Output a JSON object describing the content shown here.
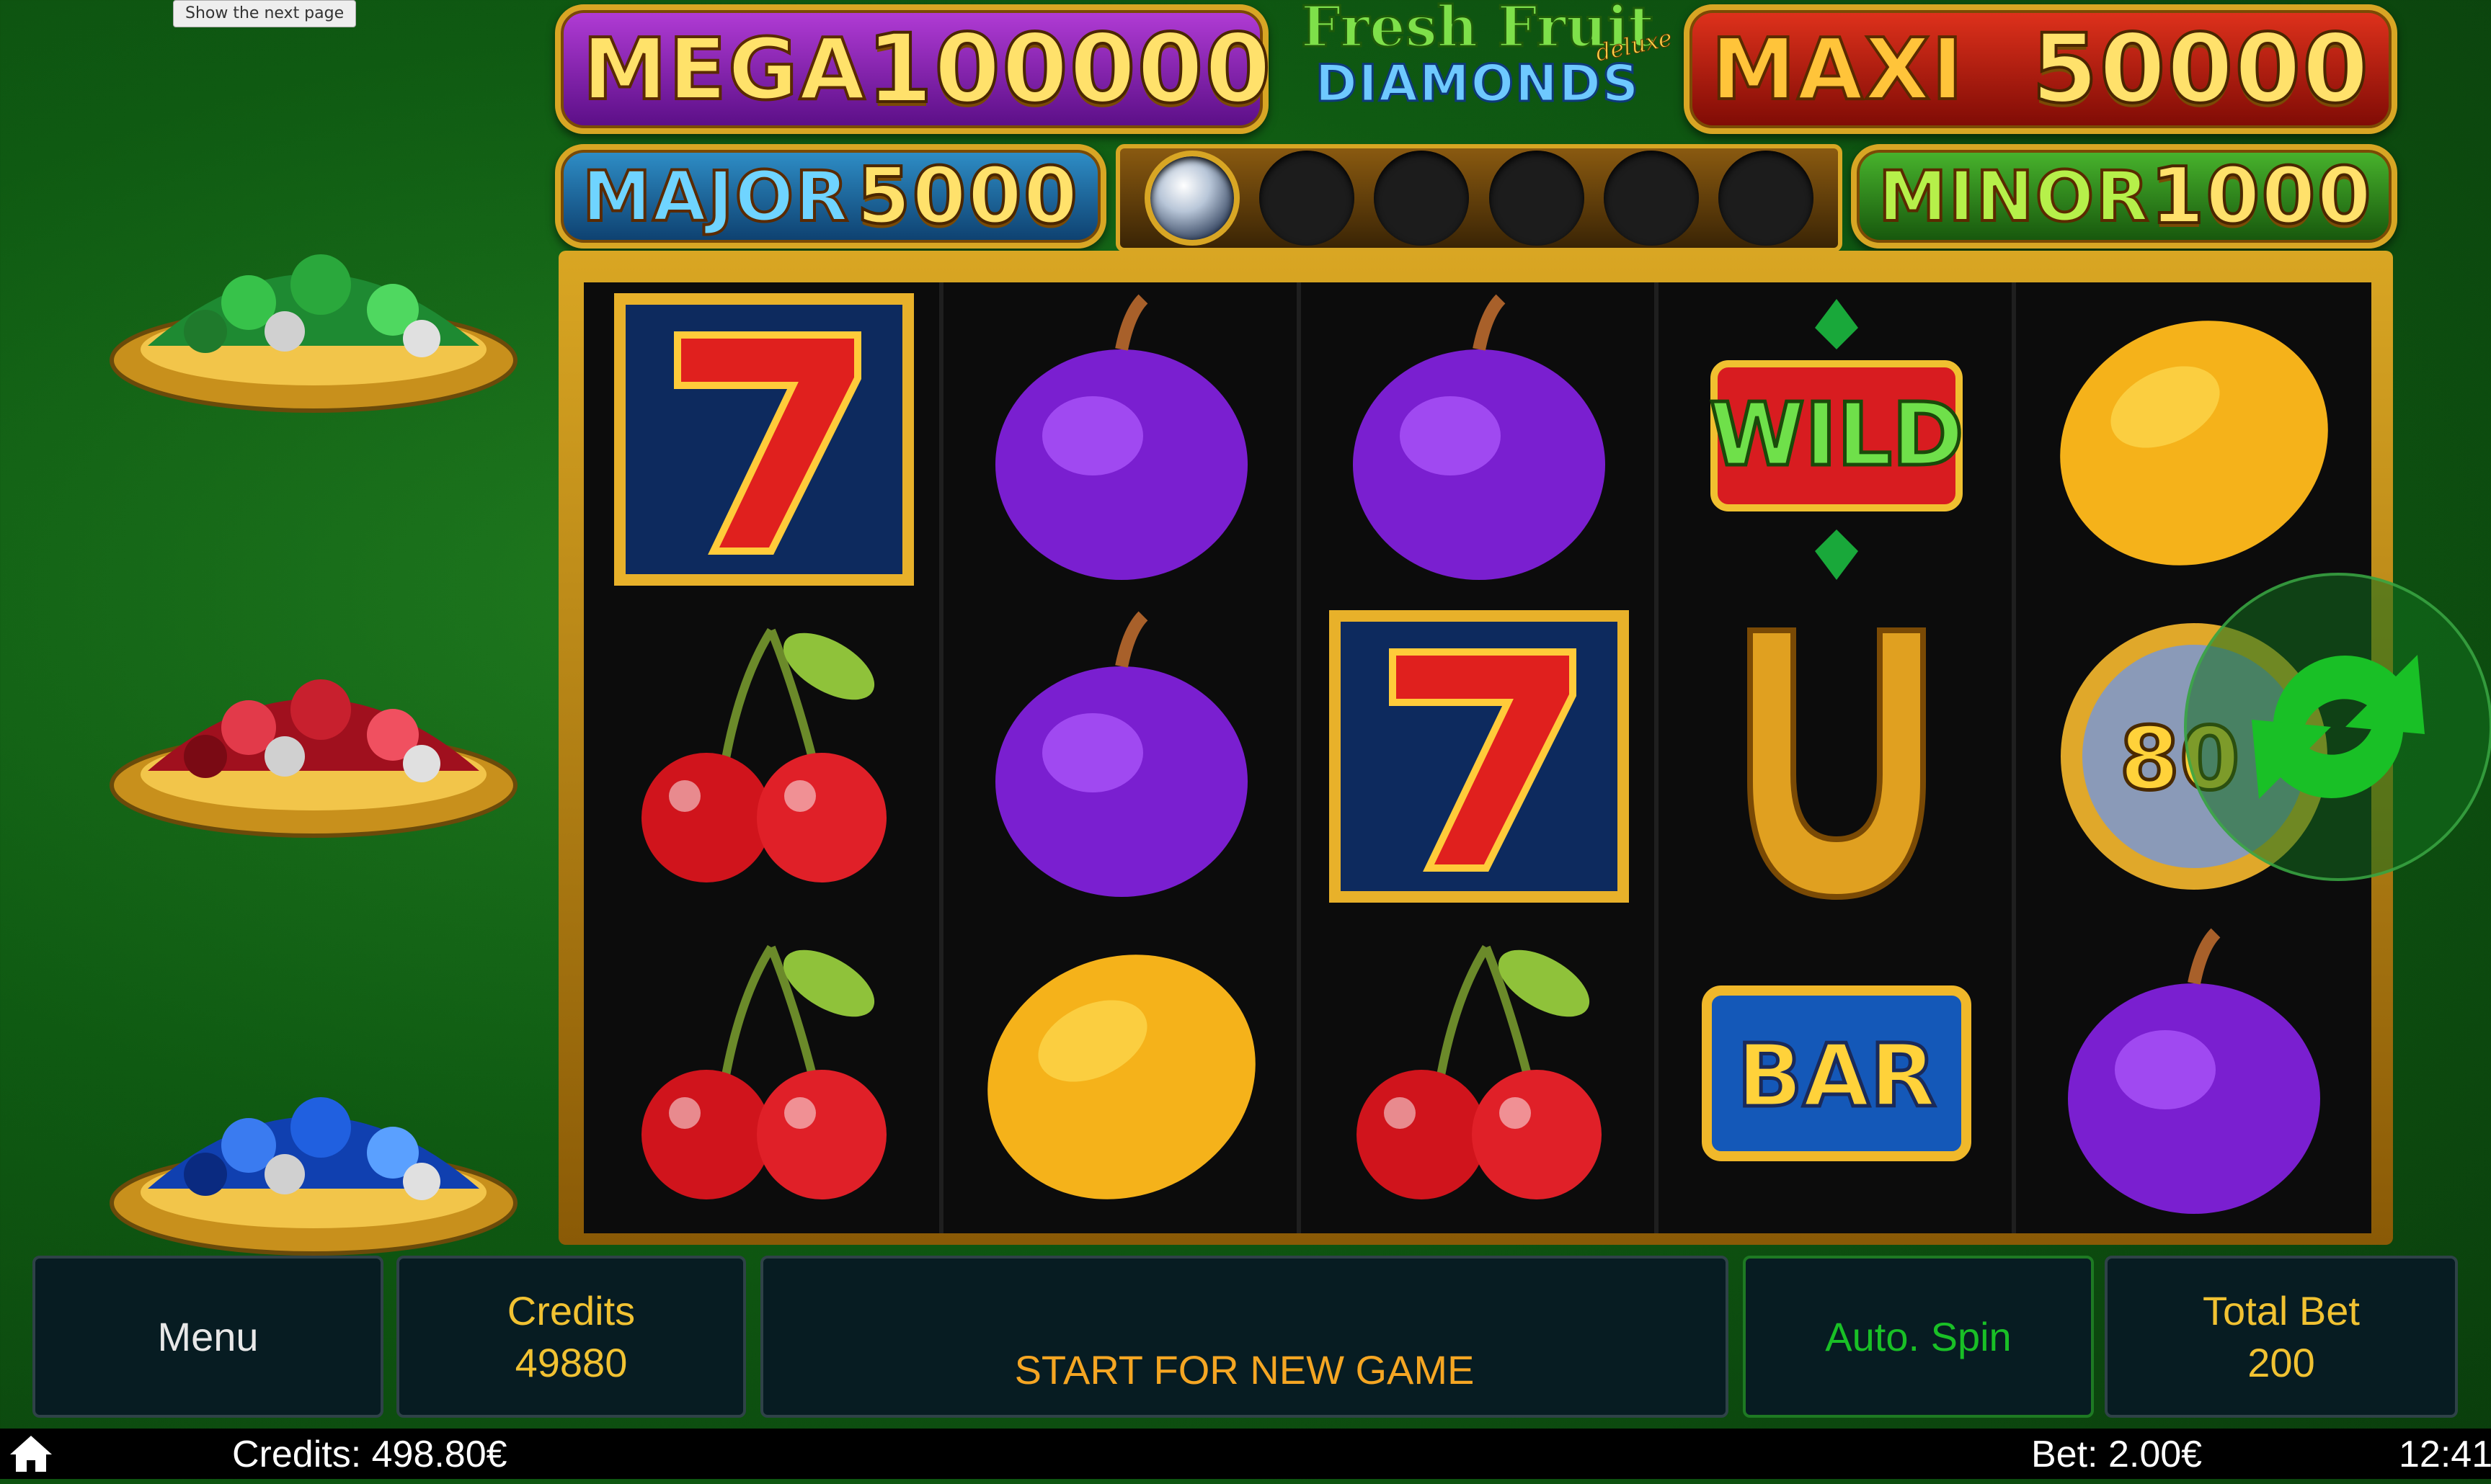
{
  "tooltip": "Show the next page",
  "logo": {
    "line1": "Fresh Fruit",
    "line2": "DIAMONDS",
    "deluxe": "deluxe"
  },
  "jackpots": {
    "mega": {
      "label": "MEGA",
      "value": "100000"
    },
    "maxi": {
      "label": "MAXI",
      "value": "50000"
    },
    "major": {
      "label": "MAJOR",
      "value": "5000"
    },
    "minor": {
      "label": "MINOR",
      "value": "1000"
    }
  },
  "progress": {
    "filled": 1,
    "total": 6
  },
  "reels": [
    [
      "seven",
      "cherries",
      "cherries"
    ],
    [
      "plum",
      "plum",
      "lemon"
    ],
    [
      "plum",
      "seven",
      "cherries"
    ],
    [
      "wild",
      "horseshoe",
      "bar"
    ],
    [
      "lemon",
      "coin",
      "plum"
    ]
  ],
  "symbol_text": {
    "wild": "WILD",
    "bar": "BAR",
    "coin": "80"
  },
  "controls": {
    "menu": "Menu",
    "credits_label": "Credits",
    "credits_value": "49880",
    "start": "START FOR NEW GAME",
    "autospin": "Auto. Spin",
    "total_bet_label": "Total Bet",
    "total_bet_value": "200"
  },
  "status_bar": {
    "credits": "Credits: 498.80€",
    "bet": "Bet: 2.00€",
    "time": "12:41"
  },
  "icons": {
    "home": "home-icon",
    "refresh": "refresh-icon"
  },
  "colors": {
    "accent_gold": "#d8a624",
    "autospin_green": "#19c026",
    "credits_gold": "#f1c232"
  }
}
